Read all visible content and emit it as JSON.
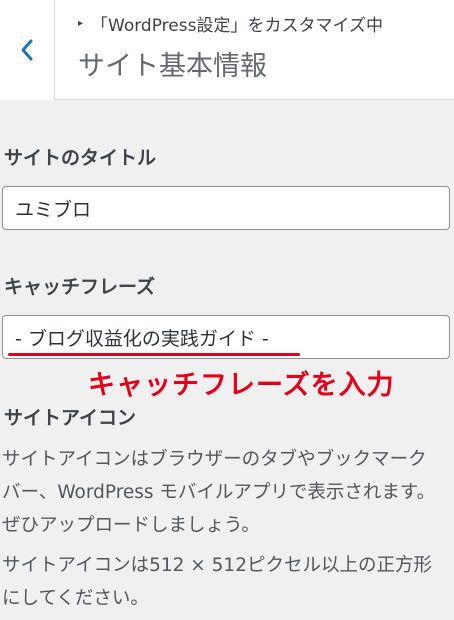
{
  "header": {
    "back_icon": "chevron-left-icon",
    "breadcrumb_arrow": "▸",
    "breadcrumb": "「WordPress設定」をカスタマイズ中",
    "title": "サイト基本情報"
  },
  "site_title": {
    "label": "サイトのタイトル",
    "value": "ユミブロ"
  },
  "tagline": {
    "label": "キャッチフレーズ",
    "value": "- ブログ収益化の実践ガイド -",
    "annotation": "キャッチフレーズを入力"
  },
  "site_icon": {
    "heading": "サイトアイコン",
    "description_lines": [
      "サイトアイコンはブラウザーのタブやブックマーク",
      "バー、WordPress モバイルアプリで表示されます。",
      "ぜひアップロードしましょう。"
    ],
    "size_note_lines": [
      "サイトアイコンは512 × 512ピクセル以上の正方形",
      "にしてください。"
    ]
  },
  "colors": {
    "accent_blue": "#2271b1",
    "annotation_red": "#e3001b"
  }
}
